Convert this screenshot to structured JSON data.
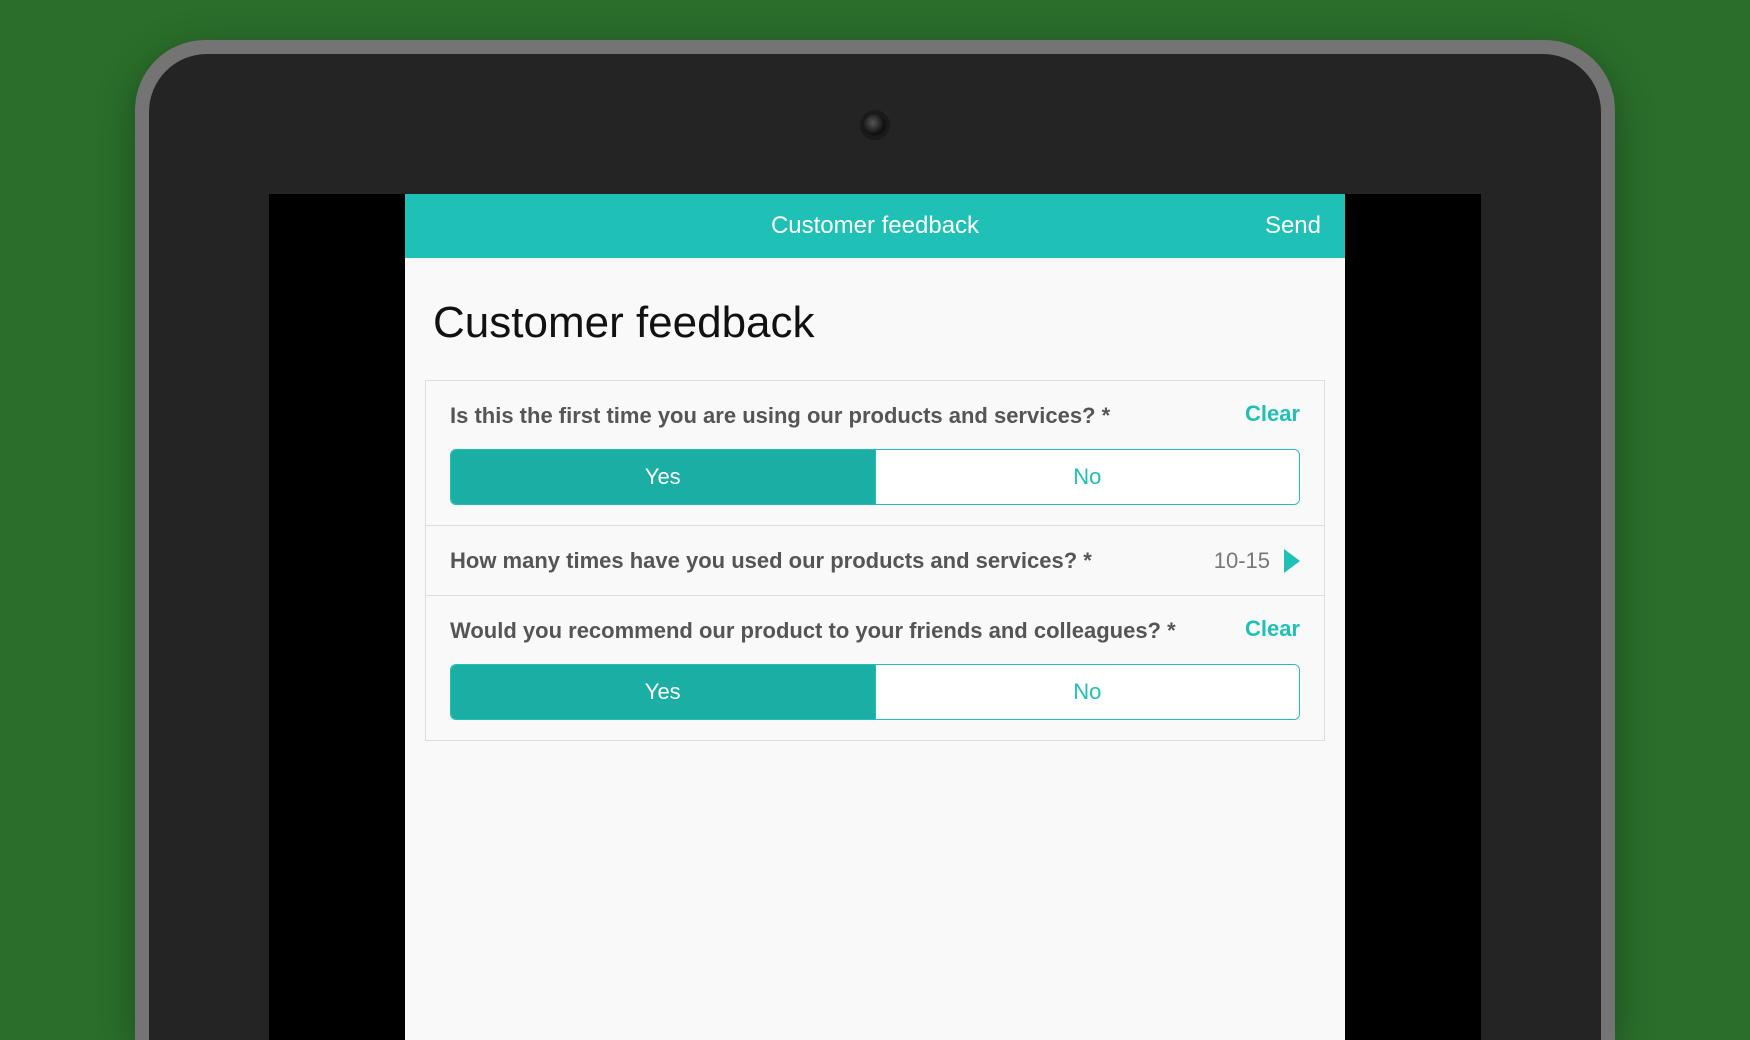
{
  "header": {
    "title": "Customer feedback",
    "send_label": "Send"
  },
  "page_title": "Customer feedback",
  "clear_label": "Clear",
  "questions": {
    "q1": {
      "label": "Is this the first time you are using our products and services? *",
      "options": {
        "yes": "Yes",
        "no": "No"
      },
      "selected": "yes"
    },
    "q2": {
      "label": "How many times have you used our products and services? *",
      "value": "10-15"
    },
    "q3": {
      "label": "Would you recommend our product to your friends and colleagues? *",
      "options": {
        "yes": "Yes",
        "no": "No"
      },
      "selected": "yes"
    }
  }
}
